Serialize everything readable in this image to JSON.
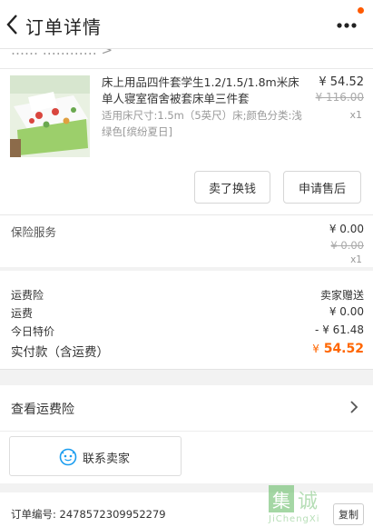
{
  "header": {
    "title": "订单详情"
  },
  "shop_partial": {
    "text": "…… ………… >"
  },
  "product": {
    "title": "床上用品四件套学生1.2/1.5/1.8m米床单人寝室宿舍被套床单三件套",
    "spec": "适用床尺寸:1.5m（5英尺）床;颜色分类:浅绿色[缤纷夏日]",
    "price": "¥ 54.52",
    "original_price": "¥ 116.00",
    "quantity": "x1",
    "refund_button": "卖了换钱",
    "aftersale_button": "申请售后"
  },
  "insurance_service": {
    "label": "保险服务",
    "price": "¥ 0.00",
    "original_price": "¥ 0.00",
    "quantity": "x1"
  },
  "summary": {
    "rows": [
      {
        "key": "运费险",
        "value": "卖家赠送"
      },
      {
        "key": "运费",
        "value": "¥ 0.00"
      },
      {
        "key": "今日特价",
        "value": "- ¥ 61.48"
      }
    ],
    "total": {
      "key": "实付款（含运费）",
      "currency": "¥",
      "amount": "54.52"
    }
  },
  "view_insurance": {
    "label": "查看运费险"
  },
  "contact": {
    "label": "联系卖家"
  },
  "order_info": {
    "order_number": "订单编号: 2478572309952279",
    "copy_label": "复制"
  },
  "watermark": {
    "cn": "集诚",
    "url": "JiChengXi"
  },
  "colors": {
    "accent": "#ff6600",
    "notification": "#ff5a00"
  }
}
